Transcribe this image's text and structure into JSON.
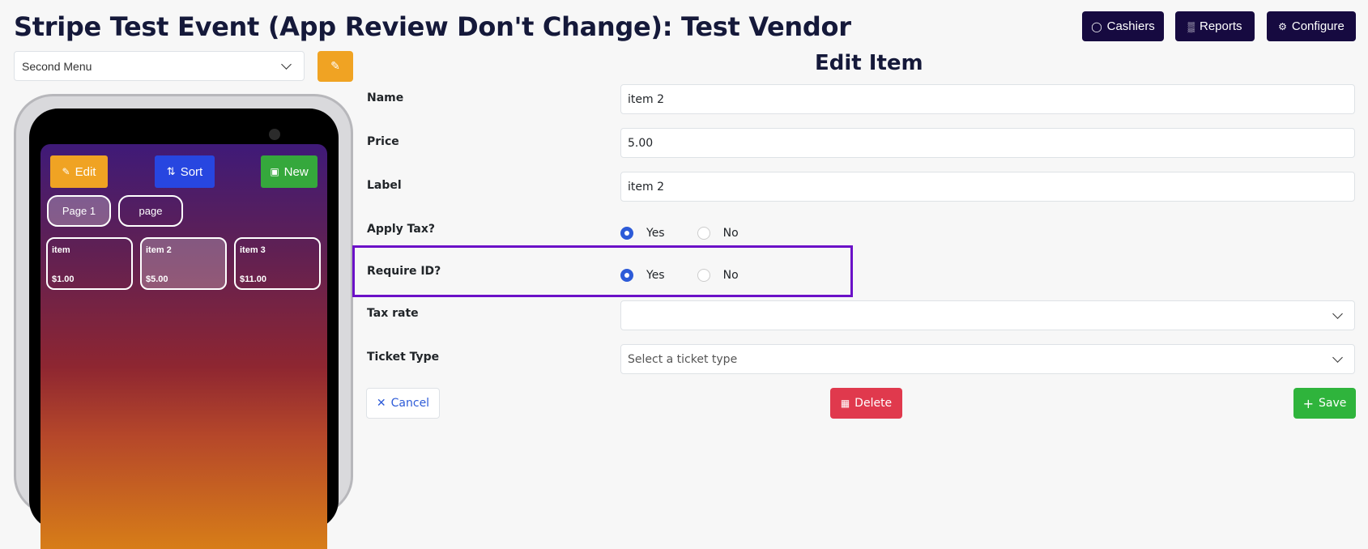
{
  "header": {
    "title": "Stripe Test Event (App Review Don't Change): Test Vendor",
    "buttons": {
      "cashiers": "Cashiers",
      "reports": "Reports",
      "configure": "Configure"
    }
  },
  "menu_select": {
    "value": "Second Menu"
  },
  "phone": {
    "edit_label": "Edit",
    "sort_label": "Sort",
    "new_label": "New",
    "pages": [
      "Page 1",
      "page"
    ],
    "items": [
      {
        "name": "item",
        "price": "$1.00"
      },
      {
        "name": "item 2",
        "price": "$5.00"
      },
      {
        "name": "item 3",
        "price": "$11.00"
      }
    ]
  },
  "form": {
    "title": "Edit Item",
    "name_label": "Name",
    "name_value": "item 2",
    "price_label": "Price",
    "price_value": "5.00",
    "label_label": "Label",
    "label_value": "item 2",
    "apply_tax_label": "Apply Tax?",
    "require_id_label": "Require ID?",
    "yes": "Yes",
    "no": "No",
    "tax_rate_label": "Tax rate",
    "tax_rate_value": "",
    "ticket_type_label": "Ticket Type",
    "ticket_type_placeholder": "Select a ticket type",
    "cancel": "Cancel",
    "delete": "Delete",
    "save": "Save"
  },
  "colors": {
    "dark_nav": "#160a40",
    "accent_blue": "#2d5bd8",
    "orange": "#f0a323",
    "red": "#e0394d",
    "green": "#2fb43c",
    "highlight": "#6b11c7"
  }
}
